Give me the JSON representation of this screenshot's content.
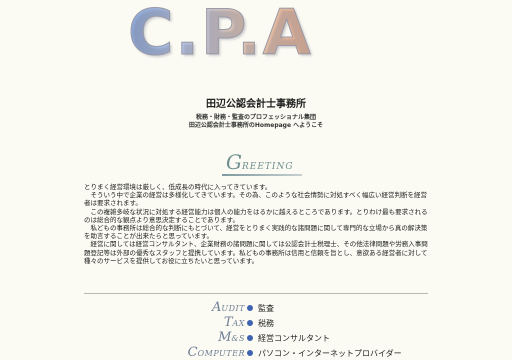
{
  "header": {
    "logo_text": "C.P.A",
    "office_name": "田辺公認会計士事務所",
    "subtitle_1": "税務・財務・監査のプロフェッショナル集団",
    "subtitle_2": "田辺公認会計士事務所のHomepage へようこそ"
  },
  "greeting": {
    "title_cap": "G",
    "title_rest": "REETING",
    "paragraphs": [
      "とりまく経営環境は厳しく、低成長の時代に入ってきています。",
      "　そういう中で企業の経営は多様化してきています。その為、このような社会情勢に対処すべく幅広い経営判断を経営者は要求されます。",
      "　この複雑多岐な状況に対処する経営能力は個人の能力をはるかに越えるところであります。とりわけ最も要求されるのは総合的な観点より意思決定することであります。",
      "　私どもの事務所は総合的な判断にもとづいて、経営をとりまく実践的な諸問題に関して専門的な立場から真の解決策を助言することが出来たらと思っています。",
      "　経営に関しては経営コンサルタント、企業財務の諸問題に関しては公認会計士税理士、その他法律問題や労務入事問題登記等は外部の優秀なスタッフと提携しています。私どもの事務所は信用と信頼を旨とし、意欲ある経営者に対して種々のサービスを提供してお役に立ちたいと思っています。"
    ]
  },
  "menu": [
    {
      "en_cap": "A",
      "en_rest": "UDIT",
      "label": "監査"
    },
    {
      "en_cap": "T",
      "en_rest": "AX",
      "label": "税務"
    },
    {
      "en_cap": "M",
      "en_rest": "&S",
      "label": "経営コンサルタント"
    },
    {
      "en_cap": "C",
      "en_rest": "OMPUTER",
      "label": "パソコン・インターネットプロバイダー"
    }
  ],
  "colors": {
    "background": "#fbfbf3",
    "menu_bullet": "#3f63b0",
    "greeting_title": "#6f8f90"
  }
}
